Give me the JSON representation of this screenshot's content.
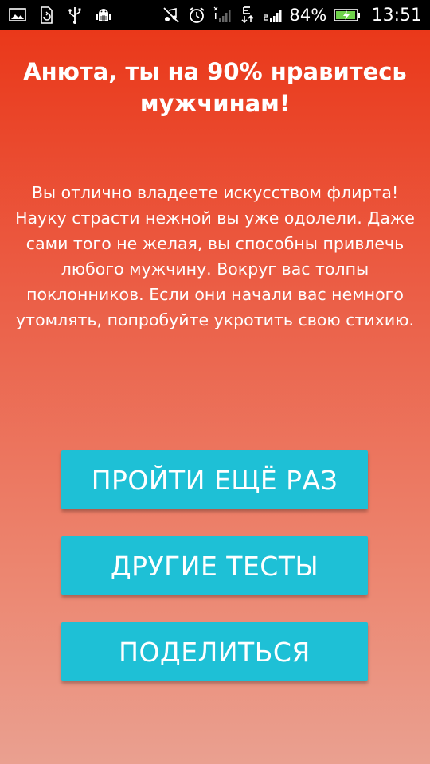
{
  "statusbar": {
    "icons_left": [
      "gallery-icon",
      "sd-sync-icon",
      "usb-icon",
      "android-debug-icon"
    ],
    "icons_right": [
      "mute-icon",
      "alarm-icon",
      "signal-sim1-icon",
      "data-e-icon",
      "signal-sim2-icon",
      "battery-charging-icon"
    ],
    "battery": "84%",
    "time": "13:51"
  },
  "result": {
    "title": "Анюта, ты на 90% нравитесь мужчинам!",
    "description": "Вы отлично владеете искусством флирта! Науку страсти нежной вы уже одолели. Даже сами того не желая, вы способны привлечь любого мужчину. Вокруг вас толпы поклонников. Если они начали вас немного утомлять, попробуйте укротить свою стихию."
  },
  "buttons": {
    "retry": "ПРОЙТИ ЕЩЁ РАЗ",
    "other_tests": "ДРУГИЕ ТЕСТЫ",
    "share": "ПОДЕЛИТЬСЯ"
  },
  "colors": {
    "gradient_top": "#ea3415",
    "gradient_bottom": "#eaa090",
    "button": "#1ec0d6",
    "statusbar": "#000000",
    "battery_fill": "#6fd24b"
  }
}
